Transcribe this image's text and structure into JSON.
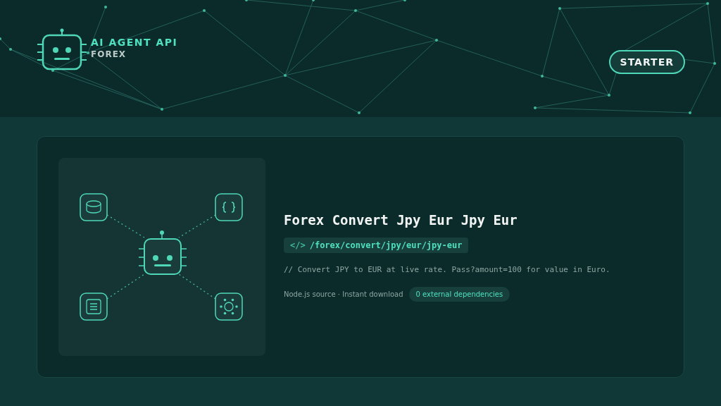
{
  "brand": {
    "title": "AI AGENT API",
    "subtitle": "FOREX"
  },
  "plan_button": {
    "label": "STARTER"
  },
  "endpoint": {
    "title": "Forex Convert Jpy Eur Jpy Eur",
    "code_icon": "</>",
    "path": "/forex/convert/jpy/eur/jpy-eur",
    "description": "// Convert JPY to EUR at live rate. Pass?amount=100 for value in Euro.",
    "meta": "Node.js source · Instant download",
    "badge": "0 external dependencies"
  }
}
